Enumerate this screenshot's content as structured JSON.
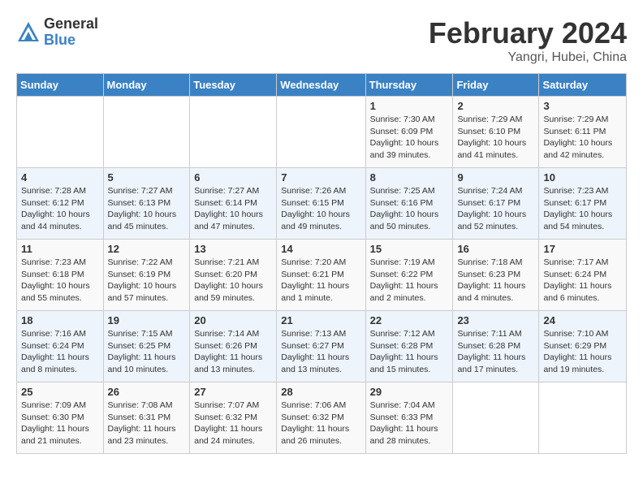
{
  "header": {
    "logo_general": "General",
    "logo_blue": "Blue",
    "month_title": "February 2024",
    "subtitle": "Yangri, Hubei, China"
  },
  "weekdays": [
    "Sunday",
    "Monday",
    "Tuesday",
    "Wednesday",
    "Thursday",
    "Friday",
    "Saturday"
  ],
  "weeks": [
    [
      {
        "day": "",
        "sunrise": "",
        "sunset": "",
        "daylight": ""
      },
      {
        "day": "",
        "sunrise": "",
        "sunset": "",
        "daylight": ""
      },
      {
        "day": "",
        "sunrise": "",
        "sunset": "",
        "daylight": ""
      },
      {
        "day": "",
        "sunrise": "",
        "sunset": "",
        "daylight": ""
      },
      {
        "day": "1",
        "sunrise": "Sunrise: 7:30 AM",
        "sunset": "Sunset: 6:09 PM",
        "daylight": "Daylight: 10 hours and 39 minutes."
      },
      {
        "day": "2",
        "sunrise": "Sunrise: 7:29 AM",
        "sunset": "Sunset: 6:10 PM",
        "daylight": "Daylight: 10 hours and 41 minutes."
      },
      {
        "day": "3",
        "sunrise": "Sunrise: 7:29 AM",
        "sunset": "Sunset: 6:11 PM",
        "daylight": "Daylight: 10 hours and 42 minutes."
      }
    ],
    [
      {
        "day": "4",
        "sunrise": "Sunrise: 7:28 AM",
        "sunset": "Sunset: 6:12 PM",
        "daylight": "Daylight: 10 hours and 44 minutes."
      },
      {
        "day": "5",
        "sunrise": "Sunrise: 7:27 AM",
        "sunset": "Sunset: 6:13 PM",
        "daylight": "Daylight: 10 hours and 45 minutes."
      },
      {
        "day": "6",
        "sunrise": "Sunrise: 7:27 AM",
        "sunset": "Sunset: 6:14 PM",
        "daylight": "Daylight: 10 hours and 47 minutes."
      },
      {
        "day": "7",
        "sunrise": "Sunrise: 7:26 AM",
        "sunset": "Sunset: 6:15 PM",
        "daylight": "Daylight: 10 hours and 49 minutes."
      },
      {
        "day": "8",
        "sunrise": "Sunrise: 7:25 AM",
        "sunset": "Sunset: 6:16 PM",
        "daylight": "Daylight: 10 hours and 50 minutes."
      },
      {
        "day": "9",
        "sunrise": "Sunrise: 7:24 AM",
        "sunset": "Sunset: 6:17 PM",
        "daylight": "Daylight: 10 hours and 52 minutes."
      },
      {
        "day": "10",
        "sunrise": "Sunrise: 7:23 AM",
        "sunset": "Sunset: 6:17 PM",
        "daylight": "Daylight: 10 hours and 54 minutes."
      }
    ],
    [
      {
        "day": "11",
        "sunrise": "Sunrise: 7:23 AM",
        "sunset": "Sunset: 6:18 PM",
        "daylight": "Daylight: 10 hours and 55 minutes."
      },
      {
        "day": "12",
        "sunrise": "Sunrise: 7:22 AM",
        "sunset": "Sunset: 6:19 PM",
        "daylight": "Daylight: 10 hours and 57 minutes."
      },
      {
        "day": "13",
        "sunrise": "Sunrise: 7:21 AM",
        "sunset": "Sunset: 6:20 PM",
        "daylight": "Daylight: 10 hours and 59 minutes."
      },
      {
        "day": "14",
        "sunrise": "Sunrise: 7:20 AM",
        "sunset": "Sunset: 6:21 PM",
        "daylight": "Daylight: 11 hours and 1 minute."
      },
      {
        "day": "15",
        "sunrise": "Sunrise: 7:19 AM",
        "sunset": "Sunset: 6:22 PM",
        "daylight": "Daylight: 11 hours and 2 minutes."
      },
      {
        "day": "16",
        "sunrise": "Sunrise: 7:18 AM",
        "sunset": "Sunset: 6:23 PM",
        "daylight": "Daylight: 11 hours and 4 minutes."
      },
      {
        "day": "17",
        "sunrise": "Sunrise: 7:17 AM",
        "sunset": "Sunset: 6:24 PM",
        "daylight": "Daylight: 11 hours and 6 minutes."
      }
    ],
    [
      {
        "day": "18",
        "sunrise": "Sunrise: 7:16 AM",
        "sunset": "Sunset: 6:24 PM",
        "daylight": "Daylight: 11 hours and 8 minutes."
      },
      {
        "day": "19",
        "sunrise": "Sunrise: 7:15 AM",
        "sunset": "Sunset: 6:25 PM",
        "daylight": "Daylight: 11 hours and 10 minutes."
      },
      {
        "day": "20",
        "sunrise": "Sunrise: 7:14 AM",
        "sunset": "Sunset: 6:26 PM",
        "daylight": "Daylight: 11 hours and 13 minutes."
      },
      {
        "day": "21",
        "sunrise": "Sunrise: 7:13 AM",
        "sunset": "Sunset: 6:27 PM",
        "daylight": "Daylight: 11 hours and 13 minutes."
      },
      {
        "day": "22",
        "sunrise": "Sunrise: 7:12 AM",
        "sunset": "Sunset: 6:28 PM",
        "daylight": "Daylight: 11 hours and 15 minutes."
      },
      {
        "day": "23",
        "sunrise": "Sunrise: 7:11 AM",
        "sunset": "Sunset: 6:28 PM",
        "daylight": "Daylight: 11 hours and 17 minutes."
      },
      {
        "day": "24",
        "sunrise": "Sunrise: 7:10 AM",
        "sunset": "Sunset: 6:29 PM",
        "daylight": "Daylight: 11 hours and 19 minutes."
      }
    ],
    [
      {
        "day": "25",
        "sunrise": "Sunrise: 7:09 AM",
        "sunset": "Sunset: 6:30 PM",
        "daylight": "Daylight: 11 hours and 21 minutes."
      },
      {
        "day": "26",
        "sunrise": "Sunrise: 7:08 AM",
        "sunset": "Sunset: 6:31 PM",
        "daylight": "Daylight: 11 hours and 23 minutes."
      },
      {
        "day": "27",
        "sunrise": "Sunrise: 7:07 AM",
        "sunset": "Sunset: 6:32 PM",
        "daylight": "Daylight: 11 hours and 24 minutes."
      },
      {
        "day": "28",
        "sunrise": "Sunrise: 7:06 AM",
        "sunset": "Sunset: 6:32 PM",
        "daylight": "Daylight: 11 hours and 26 minutes."
      },
      {
        "day": "29",
        "sunrise": "Sunrise: 7:04 AM",
        "sunset": "Sunset: 6:33 PM",
        "daylight": "Daylight: 11 hours and 28 minutes."
      },
      {
        "day": "",
        "sunrise": "",
        "sunset": "",
        "daylight": ""
      },
      {
        "day": "",
        "sunrise": "",
        "sunset": "",
        "daylight": ""
      }
    ]
  ]
}
